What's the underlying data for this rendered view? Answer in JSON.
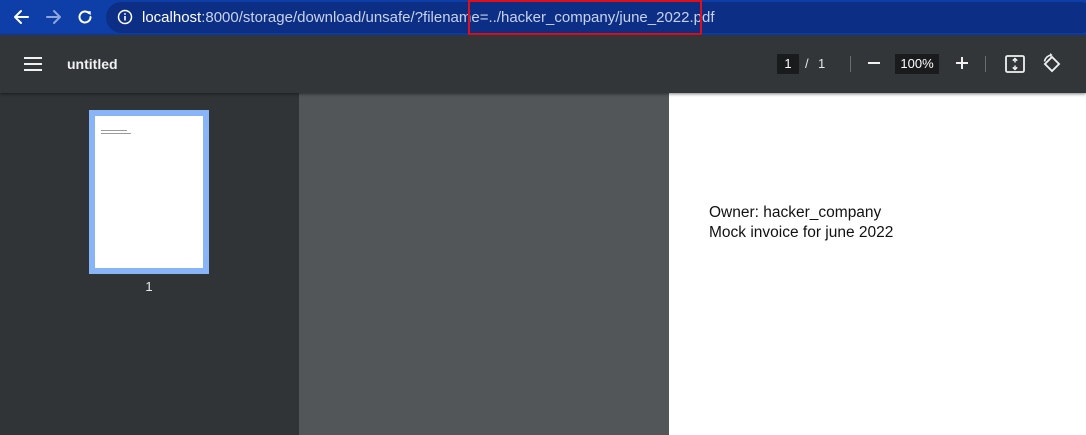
{
  "browser": {
    "url_host": "localhost",
    "url_rest": ":8000/storage/download/unsafe/?filename=../hacker_company/june_2022.pdf",
    "accent_color": "#0e3ea8",
    "highlight_color": "#e0101a",
    "icons": [
      "back-arrow-icon",
      "forward-arrow-icon",
      "reload-icon",
      "info-icon"
    ]
  },
  "viewer": {
    "title": "untitled",
    "current_page": "1",
    "page_separator": "/",
    "total_pages": "1",
    "zoom": "100%",
    "icons": [
      "menu-icon",
      "zoom-out-icon",
      "zoom-in-icon",
      "fit-page-icon",
      "rotate-icon"
    ]
  },
  "sidebar": {
    "thumbnails": [
      {
        "label": "1"
      }
    ]
  },
  "document": {
    "lines": [
      "Owner: hacker_company",
      "Mock invoice for june 2022"
    ]
  }
}
